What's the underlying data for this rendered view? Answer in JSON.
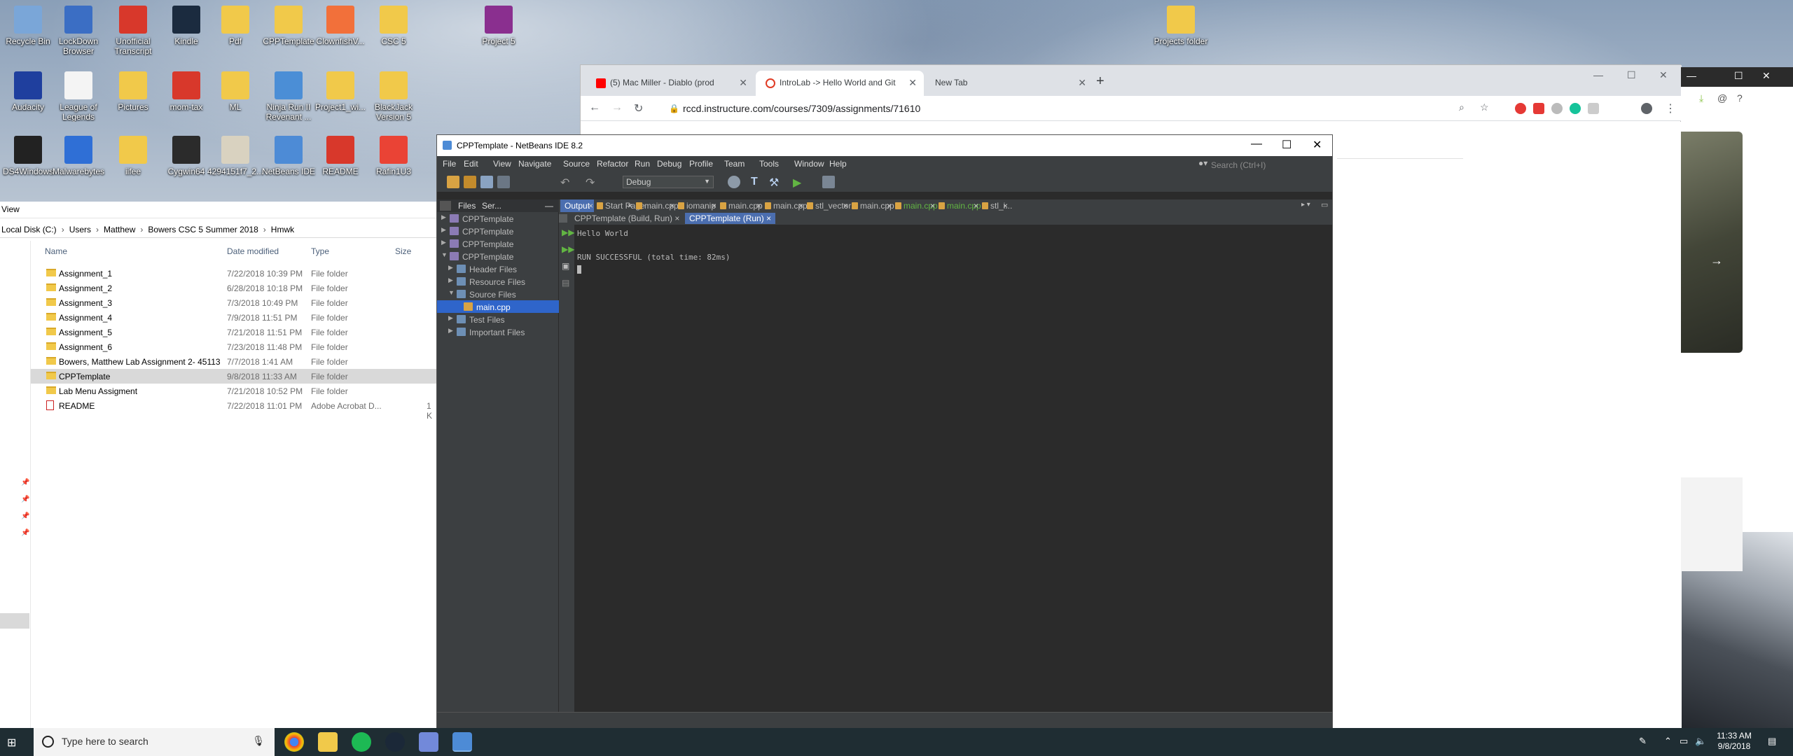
{
  "desktop": {
    "icons": [
      {
        "label": "Recycle Bin",
        "color": "#7aa6d8"
      },
      {
        "label": "LockDown Browser",
        "color": "#3b6ec4"
      },
      {
        "label": "Unofficial Transcript",
        "color": "#d8382b"
      },
      {
        "label": "Kindle",
        "color": "#1b2b3f"
      },
      {
        "label": "Pdf",
        "color": "#f1c94a"
      },
      {
        "label": "CPPTemplate",
        "color": "#f1c94a"
      },
      {
        "label": "ClownfishV...",
        "color": "#f2703a"
      },
      {
        "label": "CSC 5",
        "color": "#f1c94a"
      },
      {
        "label": "Project 5",
        "color": "#8a2f8f"
      },
      {
        "label": "Projects folder",
        "color": "#f1c94a"
      },
      {
        "label": "Audacity",
        "color": "#1f3f9e"
      },
      {
        "label": "League of Legends",
        "color": "#f4f4f4"
      },
      {
        "label": "Pictures",
        "color": "#f1c94a"
      },
      {
        "label": "mom-tax",
        "color": "#d8382b"
      },
      {
        "label": "ML",
        "color": "#f1c94a"
      },
      {
        "label": "Ninja Run II Revenant ...",
        "color": "#4b8ed6"
      },
      {
        "label": "Project1_wi...",
        "color": "#f1c94a"
      },
      {
        "label": "BlackJack Version 5",
        "color": "#f1c94a"
      },
      {
        "label": "DS4Windows",
        "color": "#222222"
      },
      {
        "label": "Malwarebytes",
        "color": "#2f6fd6"
      },
      {
        "label": "iifee",
        "color": "#f1c94a"
      },
      {
        "label": "Cygwin64",
        "color": "#2b2b2b"
      },
      {
        "label": "4294151f7_2...",
        "color": "#d9d2c0"
      },
      {
        "label": "NetBeans IDE",
        "color": "#4d8bd6"
      },
      {
        "label": "README",
        "color": "#d8382b"
      },
      {
        "label": "Rafin1U3",
        "color": "#ea4335"
      }
    ]
  },
  "explorer": {
    "view_label": "View",
    "breadcrumb": [
      "Local Disk (C:)",
      "Users",
      "Matthew",
      "Bowers CSC 5 Summer 2018",
      "Hmwk"
    ],
    "columns": {
      "name": "Name",
      "date": "Date modified",
      "type": "Type",
      "size": "Size"
    },
    "rows": [
      {
        "name": "Assignment_1",
        "date": "7/22/2018 10:39 PM",
        "type": "File folder",
        "size": ""
      },
      {
        "name": "Assignment_2",
        "date": "6/28/2018 10:18 PM",
        "type": "File folder",
        "size": ""
      },
      {
        "name": "Assignment_3",
        "date": "7/3/2018 10:49 PM",
        "type": "File folder",
        "size": ""
      },
      {
        "name": "Assignment_4",
        "date": "7/9/2018 11:51 PM",
        "type": "File folder",
        "size": ""
      },
      {
        "name": "Assignment_5",
        "date": "7/21/2018 11:51 PM",
        "type": "File folder",
        "size": ""
      },
      {
        "name": "Assignment_6",
        "date": "7/23/2018 11:48 PM",
        "type": "File folder",
        "size": ""
      },
      {
        "name": "Bowers, Matthew Lab Assignment 2- 45113",
        "date": "7/7/2018 1:41 AM",
        "type": "File folder",
        "size": ""
      },
      {
        "name": "CPPTemplate",
        "date": "9/8/2018 11:33 AM",
        "type": "File folder",
        "size": "",
        "selected": true
      },
      {
        "name": "Lab Menu Assigment",
        "date": "7/21/2018 10:52 PM",
        "type": "File folder",
        "size": ""
      },
      {
        "name": "README",
        "date": "7/22/2018 11:01 PM",
        "type": "Adobe Acrobat D...",
        "size": "1 K",
        "pdf": true
      }
    ]
  },
  "chrome": {
    "tabs": [
      {
        "title": "(5) Mac Miller - Diablo (prod",
        "fav_color": "#ff0000"
      },
      {
        "title": "IntroLab -> Hello World and Git",
        "fav_color": "#e03b24"
      },
      {
        "title": "New Tab",
        "fav_color": ""
      }
    ],
    "url": "rccd.instructure.com/courses/7309/assignments/71610"
  },
  "netbeans": {
    "title": "CPPTemplate - NetBeans IDE 8.2",
    "menu": [
      "File",
      "Edit",
      "View",
      "Navigate",
      "Source",
      "Refactor",
      "Run",
      "Debug",
      "Profile",
      "Team",
      "Tools",
      "Window",
      "Help"
    ],
    "search_placeholder": "Search (Ctrl+I)",
    "config": "Debug",
    "panel_tabs": [
      "Files",
      "Ser..."
    ],
    "tree": [
      {
        "label": "CPPTemplate",
        "level": 0,
        "exp": "▶"
      },
      {
        "label": "CPPTemplate",
        "level": 0,
        "exp": "▶"
      },
      {
        "label": "CPPTemplate",
        "level": 0,
        "exp": "▶"
      },
      {
        "label": "CPPTemplate",
        "level": 0,
        "exp": "▼"
      },
      {
        "label": "Header Files",
        "level": 1,
        "exp": "▶"
      },
      {
        "label": "Resource Files",
        "level": 1,
        "exp": "▶"
      },
      {
        "label": "Source Files",
        "level": 1,
        "exp": "▼"
      },
      {
        "label": "main.cpp",
        "level": 2,
        "exp": "",
        "selected": true
      },
      {
        "label": "Test Files",
        "level": 1,
        "exp": "▶"
      },
      {
        "label": "Important Files",
        "level": 1,
        "exp": "▶"
      }
    ],
    "editor_tabs": [
      {
        "label": "Output",
        "active": true
      },
      {
        "label": "Start Page"
      },
      {
        "label": "main.cpp"
      },
      {
        "label": "iomanip"
      },
      {
        "label": "main.cpp"
      },
      {
        "label": "main.cpp"
      },
      {
        "label": "stl_vector.h"
      },
      {
        "label": "main.cpp"
      },
      {
        "label": "main.cpp",
        "green": true
      },
      {
        "label": "main.cpp",
        "green": true
      },
      {
        "label": "stl_i..."
      }
    ],
    "output_tabs": [
      "CPPTemplate (Build, Run)",
      "CPPTemplate (Run)"
    ],
    "output_lines": [
      "Hello World",
      "",
      "RUN SUCCESSFUL (total time: 82ms)"
    ]
  },
  "taskbar": {
    "search_placeholder": "Type here to search",
    "time": "11:33 AM",
    "date": "9/8/2018"
  }
}
